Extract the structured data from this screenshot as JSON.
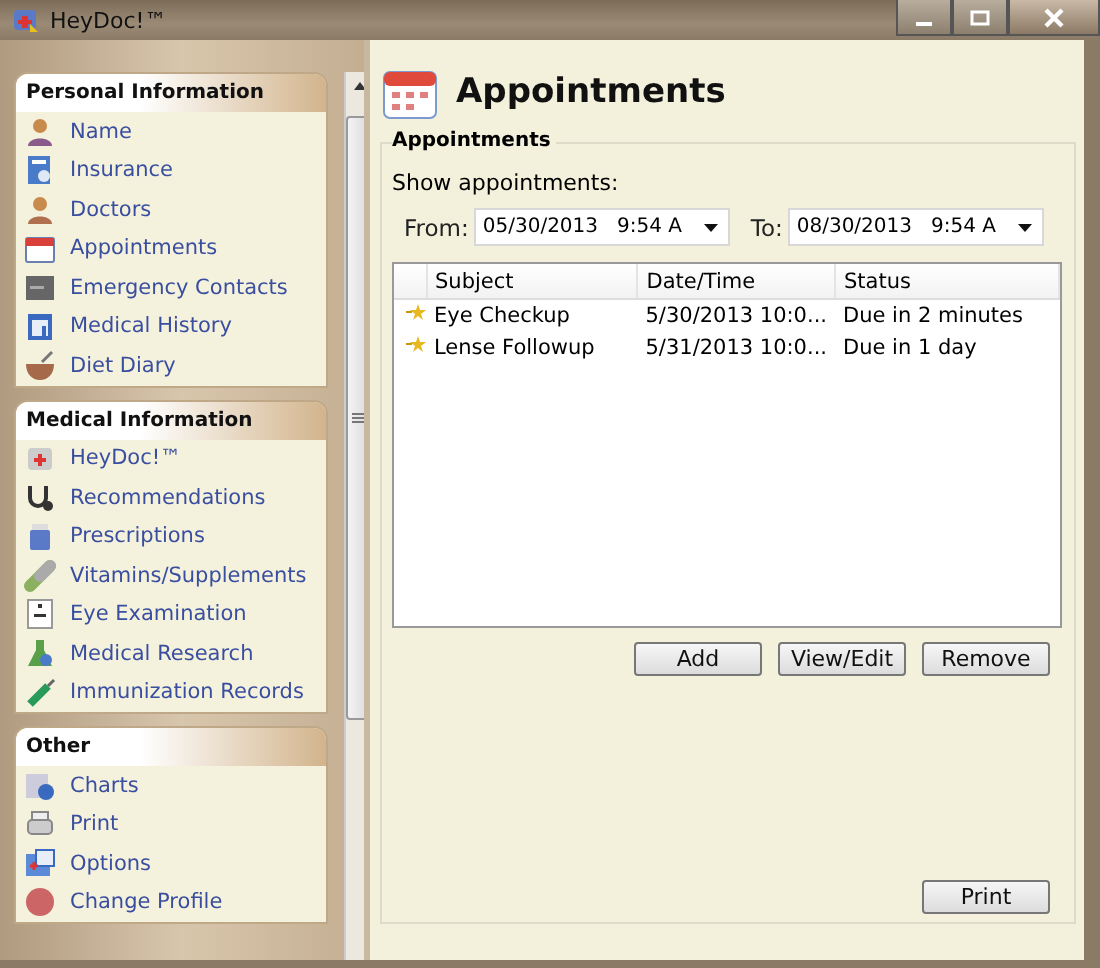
{
  "window": {
    "title": "HeyDoc!™"
  },
  "sidebar": {
    "sections": [
      {
        "title": "Personal Information",
        "items": [
          {
            "label": "Name"
          },
          {
            "label": "Insurance"
          },
          {
            "label": "Doctors"
          },
          {
            "label": "Appointments"
          },
          {
            "label": "Emergency Contacts"
          },
          {
            "label": "Medical History"
          },
          {
            "label": "Diet Diary"
          }
        ]
      },
      {
        "title": "Medical Information",
        "items": [
          {
            "label": "HeyDoc!™"
          },
          {
            "label": "Recommendations"
          },
          {
            "label": "Prescriptions"
          },
          {
            "label": "Vitamins/Supplements"
          },
          {
            "label": "Eye Examination"
          },
          {
            "label": "Medical Research"
          },
          {
            "label": "Immunization Records"
          }
        ]
      },
      {
        "title": "Other",
        "items": [
          {
            "label": "Charts"
          },
          {
            "label": "Print"
          },
          {
            "label": "Options"
          },
          {
            "label": "Change Profile"
          }
        ]
      }
    ]
  },
  "page": {
    "title": "Appointments",
    "group_title": "Appointments",
    "filter_label": "Show appointments:",
    "from": {
      "label": "From:",
      "value": "05/30/2013   9:54 A"
    },
    "to": {
      "label": "To:",
      "value": "08/30/2013   9:54 A"
    },
    "table": {
      "columns": [
        "Subject",
        "Date/Time",
        "Status"
      ],
      "rows": [
        {
          "subject": "Eye Checkup",
          "datetime": "5/30/2013 10:0...",
          "status": "Due in 2 minutes"
        },
        {
          "subject": "Lense Followup",
          "datetime": "5/31/2013 10:0...",
          "status": "Due in 1 day"
        }
      ]
    },
    "buttons": [
      "Add",
      "View/Edit",
      "Remove"
    ],
    "print_button": "Print"
  }
}
